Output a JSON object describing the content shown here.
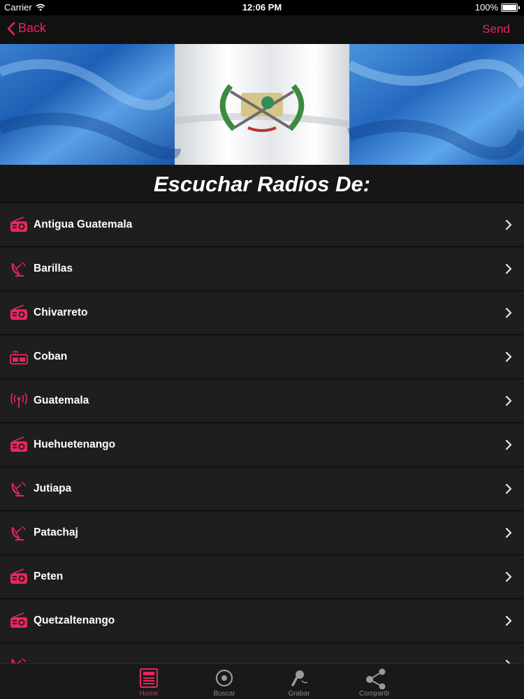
{
  "status_bar": {
    "carrier": "Carrier",
    "time": "12:06 PM",
    "battery": "100%"
  },
  "nav": {
    "back_label": "Back",
    "send_label": "Send"
  },
  "colors": {
    "accent": "#e8265c",
    "row_bg": "#1e1e1e",
    "background": "#0f0f0f"
  },
  "heading": "Escuchar Radios De:",
  "list": [
    {
      "label": "Antigua Guatemala",
      "icon": "radio-icon"
    },
    {
      "label": "Barillas",
      "icon": "satellite-dish-icon"
    },
    {
      "label": "Chivarreto",
      "icon": "radio-icon"
    },
    {
      "label": "Coban",
      "icon": "wifi-radio-icon"
    },
    {
      "label": "Guatemala",
      "icon": "broadcast-antenna-icon"
    },
    {
      "label": "Huehuetenango",
      "icon": "radio-icon"
    },
    {
      "label": "Jutiapa",
      "icon": "satellite-dish-icon"
    },
    {
      "label": "Patachaj",
      "icon": "satellite-dish-icon"
    },
    {
      "label": "Peten",
      "icon": "radio-icon"
    },
    {
      "label": "Quetzaltenango",
      "icon": "radio-icon"
    },
    {
      "label": "",
      "icon": "satellite-dish-icon"
    }
  ],
  "tabs": [
    {
      "label": "Home",
      "icon": "home-icon",
      "active": true
    },
    {
      "label": "Buscar",
      "icon": "search-disc-icon",
      "active": false
    },
    {
      "label": "Grabar",
      "icon": "microphone-icon",
      "active": false
    },
    {
      "label": "Compartir",
      "icon": "share-icon",
      "active": false
    }
  ]
}
